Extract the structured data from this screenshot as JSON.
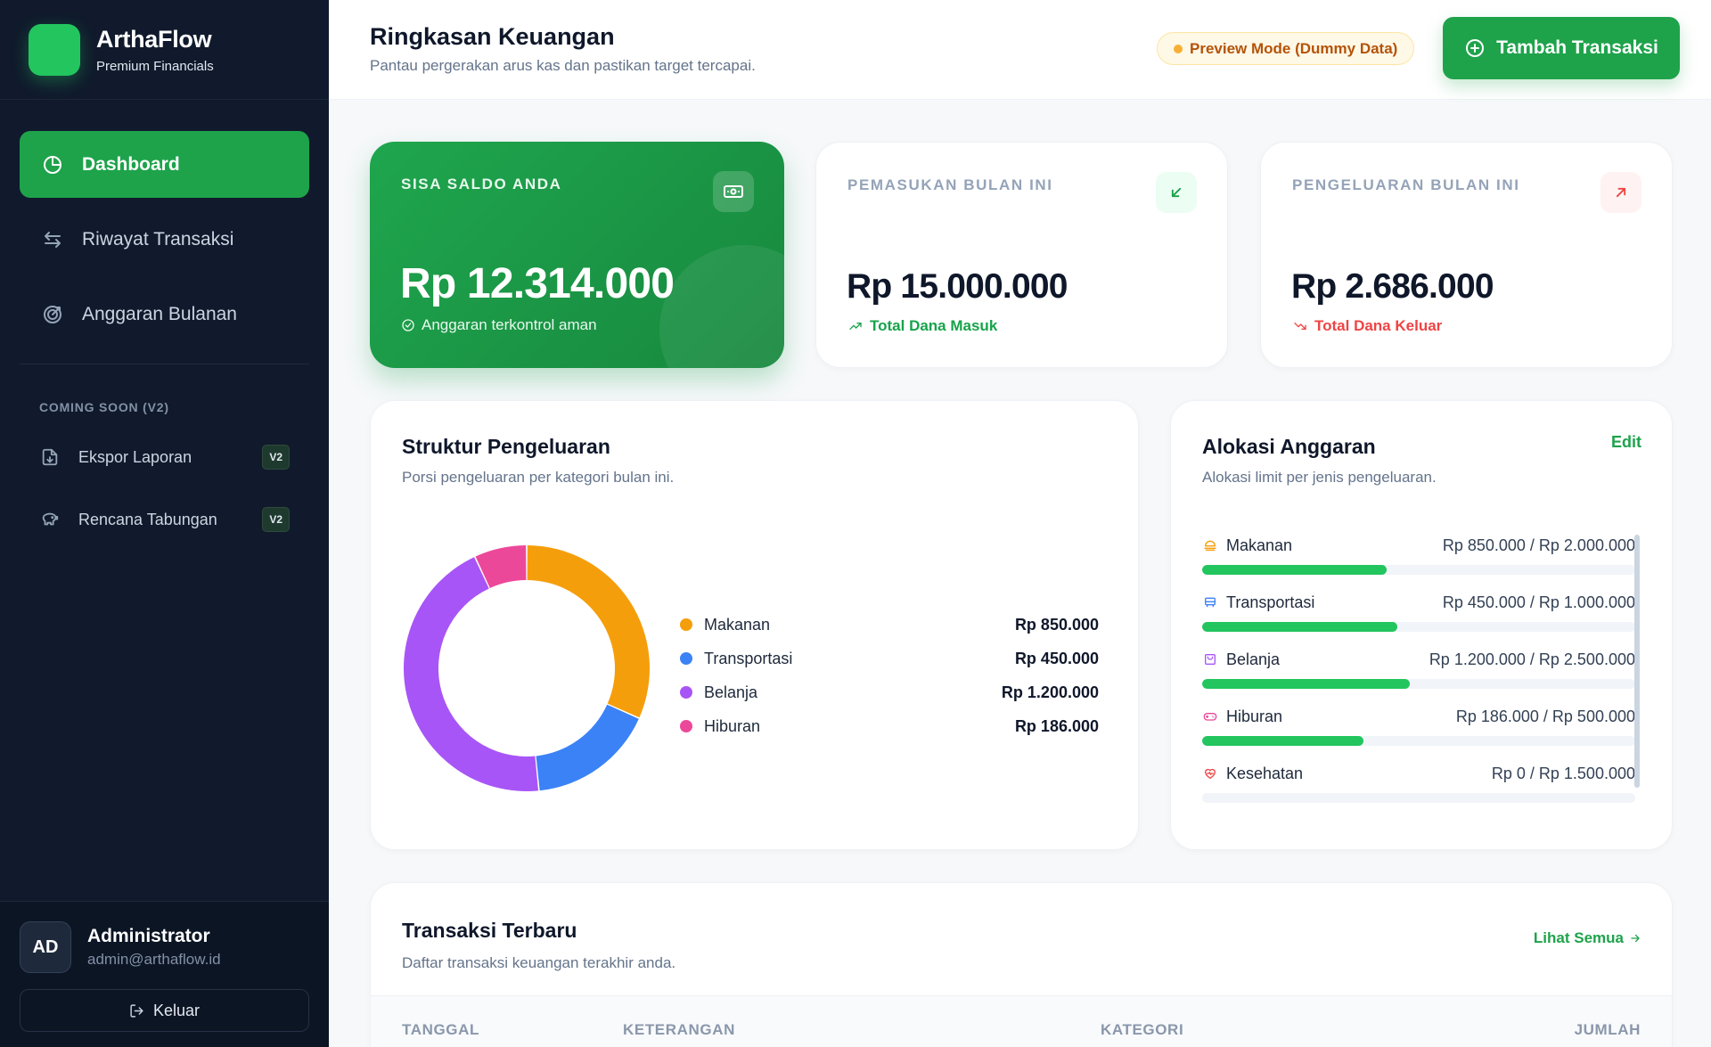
{
  "brand": {
    "name": "ArthaFlow",
    "subtitle": "Premium Financials"
  },
  "nav": {
    "items": [
      {
        "label": "Dashboard",
        "icon": "pie-chart-icon",
        "active": true
      },
      {
        "label": "Riwayat Transaksi",
        "icon": "arrows-swap-icon",
        "active": false
      },
      {
        "label": "Anggaran Bulanan",
        "icon": "target-icon",
        "active": false
      }
    ],
    "section_label": "COMING SOON (V2)",
    "soon_items": [
      {
        "label": "Ekspor Laporan",
        "icon": "file-download-icon",
        "badge": "V2"
      },
      {
        "label": "Rencana Tabungan",
        "icon": "piggy-bank-icon",
        "badge": "V2"
      }
    ]
  },
  "profile": {
    "initials": "AD",
    "name": "Administrator",
    "email": "admin@arthaflow.id",
    "logout_label": "Keluar"
  },
  "header": {
    "title": "Ringkasan Keuangan",
    "subtitle": "Pantau pergerakan arus kas dan pastikan target tercapai.",
    "preview_badge": "Preview Mode (Dummy Data)",
    "add_button": "Tambah Transaksi"
  },
  "stats": {
    "balance": {
      "label": "SISA SALDO ANDA",
      "value": "Rp 12.314.000",
      "note": "Anggaran terkontrol aman",
      "icon": "cash-icon"
    },
    "income": {
      "label": "PEMASUKAN BULAN INI",
      "value": "Rp 15.000.000",
      "note": "Total Dana Masuk",
      "icon": "arrow-down-left-icon"
    },
    "expense": {
      "label": "PENGELUARAN BULAN INI",
      "value": "Rp 2.686.000",
      "note": "Total Dana Keluar",
      "icon": "arrow-up-right-icon"
    }
  },
  "struktur": {
    "title": "Struktur Pengeluaran",
    "subtitle": "Porsi pengeluaran per kategori bulan ini.",
    "legend_values": [
      "Rp 850.000",
      "Rp 450.000",
      "Rp 1.200.000",
      "Rp 186.000"
    ]
  },
  "chart_data": {
    "type": "pie",
    "categories": [
      "Makanan",
      "Transportasi",
      "Belanja",
      "Hiburan"
    ],
    "values": [
      850000,
      450000,
      1200000,
      186000
    ],
    "colors": [
      "#f59e0b",
      "#3b82f6",
      "#a855f7",
      "#ec4899"
    ]
  },
  "alokasi": {
    "title": "Alokasi Anggaran",
    "subtitle": "Alokasi limit per jenis pengeluaran.",
    "edit_label": "Edit",
    "items": [
      {
        "name": "Makanan",
        "amount": "Rp 850.000 / Rp 2.000.000",
        "progress": 0.425,
        "icon": "food-icon",
        "icon_color": "#f59e0b"
      },
      {
        "name": "Transportasi",
        "amount": "Rp 450.000 / Rp 1.000.000",
        "progress": 0.45,
        "icon": "car-icon",
        "icon_color": "#3b82f6"
      },
      {
        "name": "Belanja",
        "amount": "Rp 1.200.000 / Rp 2.500.000",
        "progress": 0.48,
        "icon": "shopping-bag-icon",
        "icon_color": "#a855f7"
      },
      {
        "name": "Hiburan",
        "amount": "Rp 186.000 / Rp 500.000",
        "progress": 0.372,
        "icon": "gamepad-icon",
        "icon_color": "#ec4899"
      },
      {
        "name": "Kesehatan",
        "amount": "Rp 0 / Rp 1.500.000",
        "progress": 0,
        "icon": "heart-pulse-icon",
        "icon_color": "#ef4444"
      }
    ]
  },
  "transaksi": {
    "title": "Transaksi Terbaru",
    "subtitle": "Daftar transaksi keuangan terakhir anda.",
    "view_all": "Lihat Semua",
    "columns": [
      "TANGGAL",
      "KETERANGAN",
      "KATEGORI",
      "JUMLAH"
    ]
  },
  "colors": {
    "accent": "#1ea34b",
    "sidebar": "#101a2c",
    "income": "#16a34a",
    "expense": "#ef4444"
  }
}
